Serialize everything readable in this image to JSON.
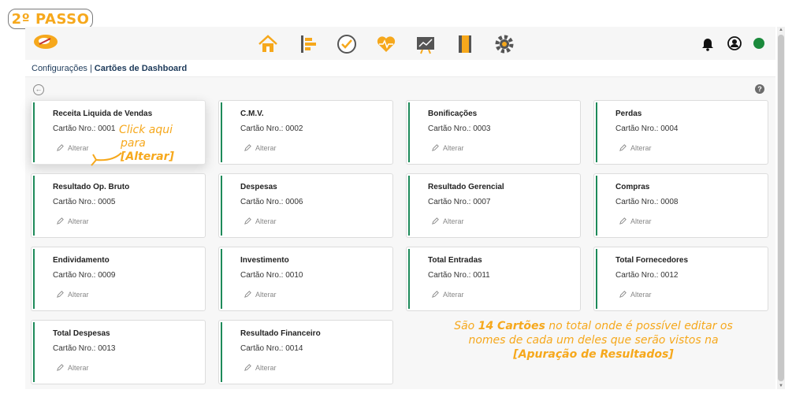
{
  "badge": "2º PASSO",
  "breadcrumb": {
    "parent": "Configurações",
    "separator": "|",
    "current": "Cartões de Dashboard"
  },
  "topbar": {
    "icons": [
      "home-icon",
      "timeline-icon",
      "check-circle-icon",
      "heart-pulse-icon",
      "chart-board-icon",
      "notebook-icon",
      "settings-gear-icon"
    ],
    "right_icons": [
      "bell-icon",
      "user-icon",
      "status-dot-icon"
    ],
    "colors": {
      "accent": "#f6a81c",
      "status": "#1b8a3c",
      "card_bar": "#1e8a5a"
    }
  },
  "controls": {
    "back_icon": "back-arrow-icon",
    "help_label": "?"
  },
  "cards": [
    {
      "title": "Receita Liquida de Vendas",
      "number": "Cartão Nro.: 0001",
      "edit": "Alterar"
    },
    {
      "title": "C.M.V.",
      "number": "Cartão Nro.: 0002",
      "edit": "Alterar"
    },
    {
      "title": "Bonificações",
      "number": "Cartão Nro.: 0003",
      "edit": "Alterar"
    },
    {
      "title": "Perdas",
      "number": "Cartão Nro.: 0004",
      "edit": "Alterar"
    },
    {
      "title": "Resultado Op. Bruto",
      "number": "Cartão Nro.: 0005",
      "edit": "Alterar"
    },
    {
      "title": "Despesas",
      "number": "Cartão Nro.: 0006",
      "edit": "Alterar"
    },
    {
      "title": "Resultado Gerencial",
      "number": "Cartão Nro.: 0007",
      "edit": "Alterar"
    },
    {
      "title": "Compras",
      "number": "Cartão Nro.: 0008",
      "edit": "Alterar"
    },
    {
      "title": "Endividamento",
      "number": "Cartão Nro.: 0009",
      "edit": "Alterar"
    },
    {
      "title": "Investimento",
      "number": "Cartão Nro.: 0010",
      "edit": "Alterar"
    },
    {
      "title": "Total Entradas",
      "number": "Cartão Nro.: 0011",
      "edit": "Alterar"
    },
    {
      "title": "Total Fornecedores",
      "number": "Cartão Nro.: 0012",
      "edit": "Alterar"
    },
    {
      "title": "Total Despesas",
      "number": "Cartão Nro.: 0013",
      "edit": "Alterar"
    },
    {
      "title": "Resultado Financeiro",
      "number": "Cartão Nro.: 0014",
      "edit": "Alterar"
    }
  ],
  "annotations": {
    "click_line1": "Click aqui",
    "click_line2_prefix": "para ",
    "click_line2_bold": "[Alterar]",
    "info_prefix": "São ",
    "info_bold": "14 Cartões",
    "info_middle": " no total onde é possível editar os nomes de cada um deles que serão vistos  na",
    "info_final": "[Apuração de Resultados]"
  }
}
